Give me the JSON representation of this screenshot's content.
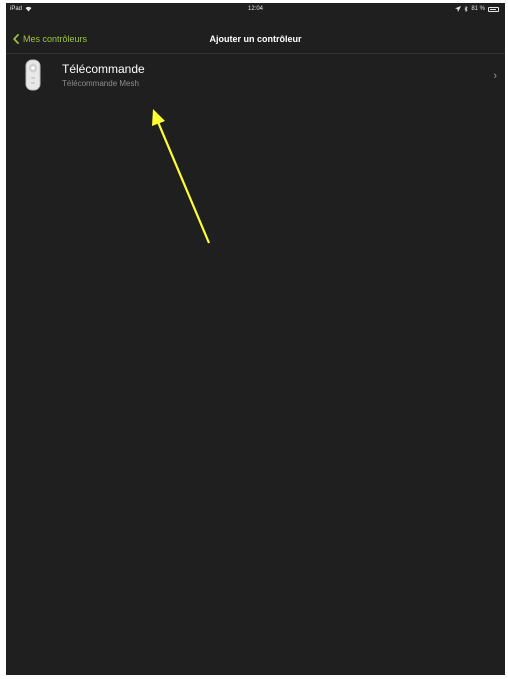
{
  "status_bar": {
    "device": "iPad",
    "time": "12:04",
    "battery_text": "81 %",
    "battery_level": 0.81
  },
  "nav": {
    "back_label": "Mes contrôleurs",
    "title": "Ajouter un contrôleur"
  },
  "list": {
    "items": [
      {
        "title": "Télécommande",
        "subtitle": "Télécommande Mesh",
        "icon": "remote-control-icon"
      }
    ]
  },
  "colors": {
    "background": "#1f1f1f",
    "accent": "#9bc53d",
    "annotation": "#ffff33"
  }
}
